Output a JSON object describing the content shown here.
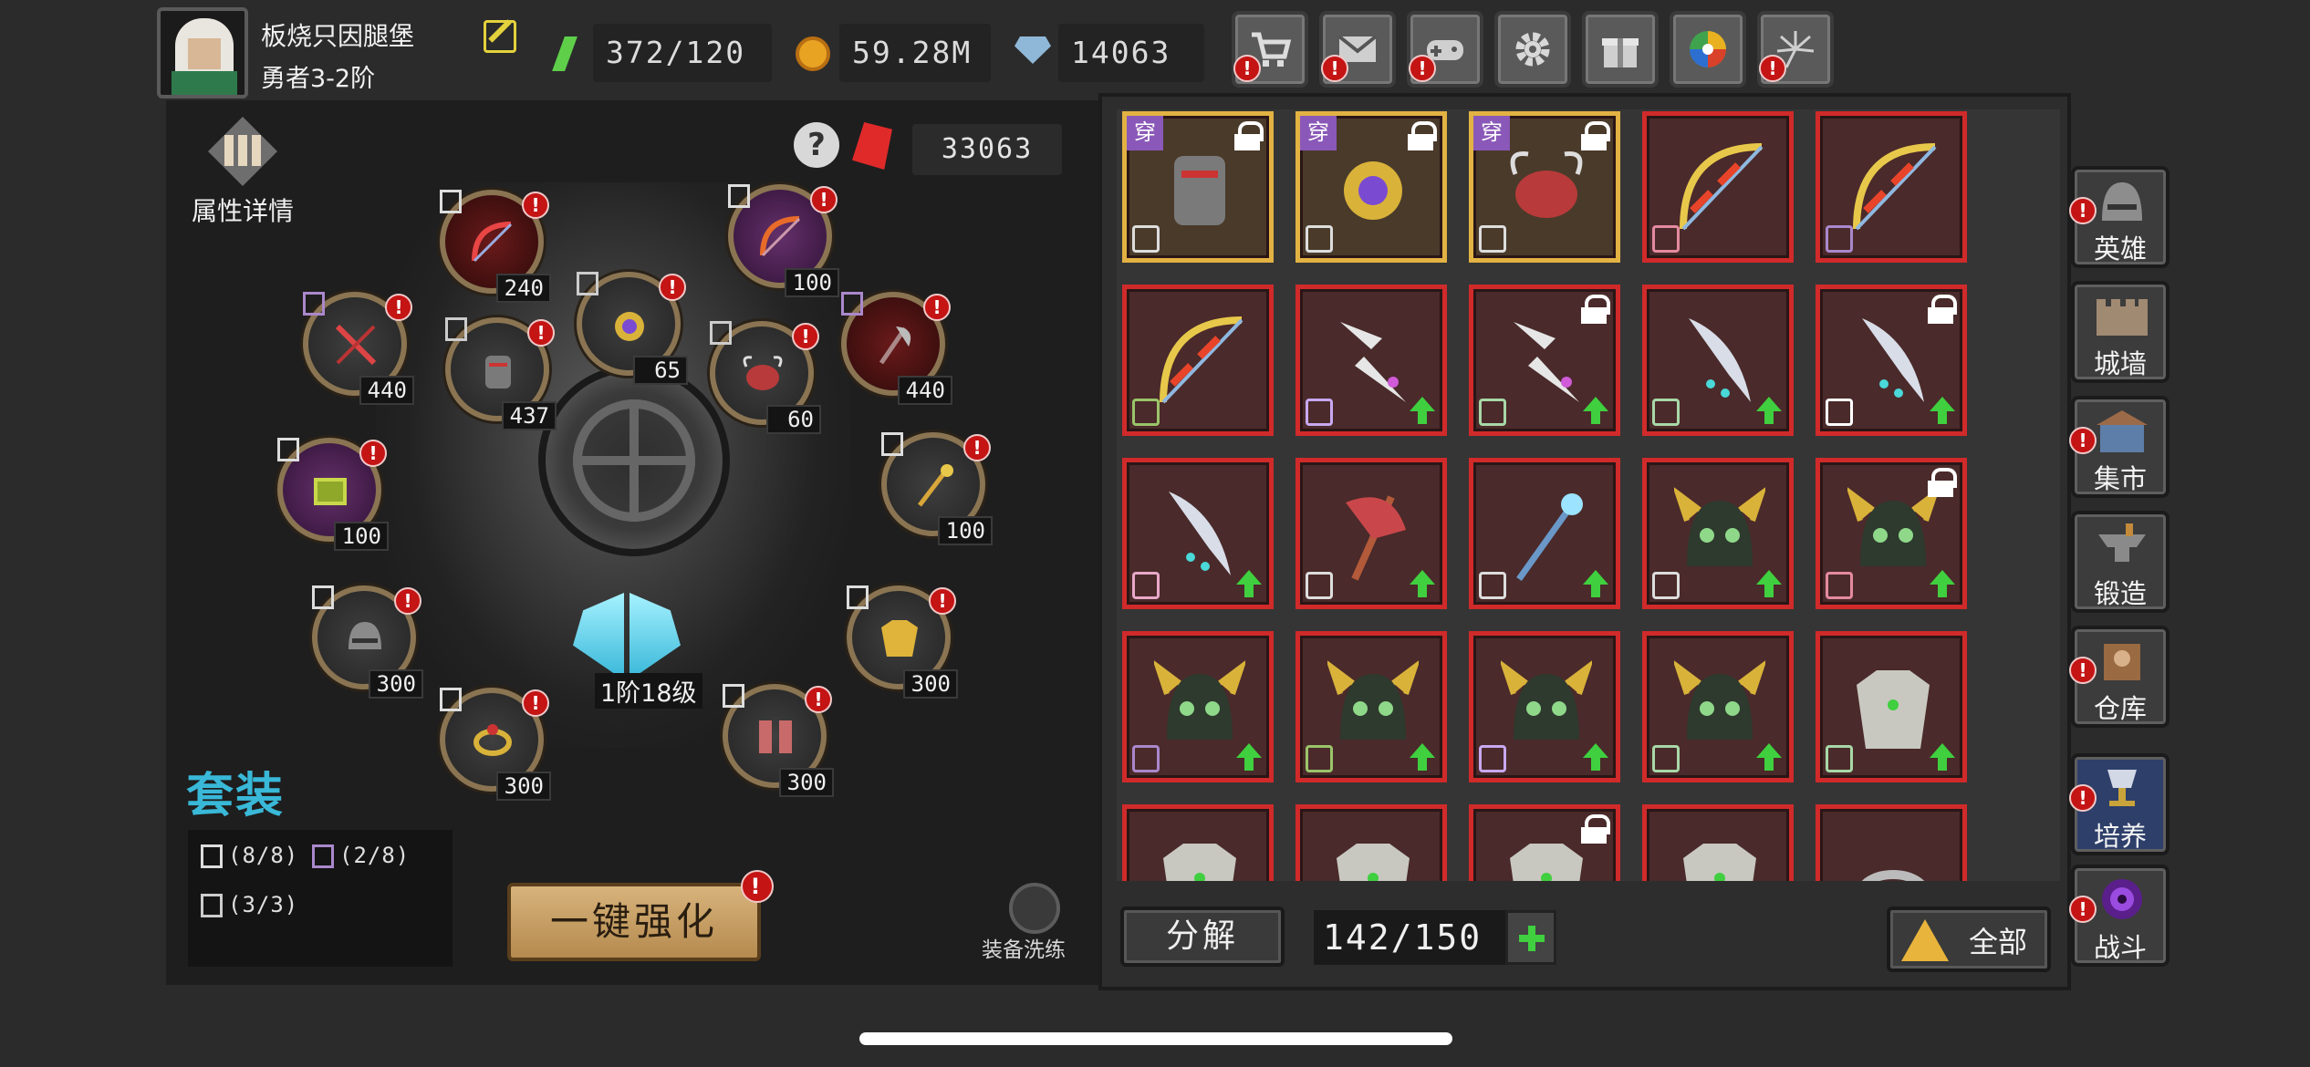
{
  "player": {
    "name": "板烧只因腿堡",
    "rank": "勇者3-2阶"
  },
  "resources": {
    "stamina": "372/120",
    "gold": "59.28M",
    "gems": "14063"
  },
  "top_buttons": [
    {
      "icon": "shop-cart-icon",
      "badge": "!"
    },
    {
      "icon": "mail-icon",
      "badge": "!"
    },
    {
      "icon": "gamepad-icon",
      "badge": "!"
    },
    {
      "icon": "gear-icon",
      "badge": ""
    },
    {
      "icon": "gift-icon",
      "badge": ""
    },
    {
      "icon": "color-wheel-icon",
      "badge": ""
    },
    {
      "icon": "fireworks-icon",
      "badge": "!"
    }
  ],
  "left_panel": {
    "attr_label": "属性详情",
    "ruby_count": "33063",
    "help_glyph": "?",
    "center_level": "1阶18级",
    "set_title": "套装",
    "sets": [
      "(8/8)",
      "(2/8)",
      "(3/3)"
    ],
    "enhance_label": "一键强化",
    "refine_label": "装备洗练",
    "slots": [
      {
        "level": "240",
        "badge": "!"
      },
      {
        "level": "100",
        "badge": "!"
      },
      {
        "level": "440",
        "badge": "!"
      },
      {
        "level": "437",
        "badge": "!"
      },
      {
        "level": "65",
        "badge": "!"
      },
      {
        "level": "60",
        "badge": "!"
      },
      {
        "level": "440",
        "badge": "!"
      },
      {
        "level": "100",
        "badge": "!"
      },
      {
        "level": "100",
        "badge": "!"
      },
      {
        "level": "300",
        "badge": "!"
      },
      {
        "level": "300",
        "badge": "!"
      },
      {
        "level": "300",
        "badge": "!"
      },
      {
        "level": "300",
        "badge": "!"
      }
    ]
  },
  "inventory": {
    "wear_label": "穿",
    "decompose_label": "分解",
    "capacity": "142/150",
    "filter_label": "全部",
    "items": [
      {
        "art": "armor",
        "wear": true,
        "lock": true,
        "up": false,
        "frame": "gold"
      },
      {
        "art": "amulet",
        "wear": true,
        "lock": true,
        "up": false,
        "frame": "gold"
      },
      {
        "art": "crab-armor",
        "wear": true,
        "lock": true,
        "up": false,
        "frame": "gold"
      },
      {
        "art": "bow",
        "wear": false,
        "lock": false,
        "up": false,
        "frame": "red"
      },
      {
        "art": "bow",
        "wear": false,
        "lock": false,
        "up": false,
        "frame": "red"
      },
      {
        "art": "bow",
        "wear": false,
        "lock": false,
        "up": false,
        "frame": "red"
      },
      {
        "art": "lightning-sword",
        "wear": false,
        "lock": false,
        "up": true,
        "frame": "red"
      },
      {
        "art": "lightning-sword",
        "wear": false,
        "lock": true,
        "up": true,
        "frame": "red"
      },
      {
        "art": "crystal-blade",
        "wear": false,
        "lock": false,
        "up": true,
        "frame": "red"
      },
      {
        "art": "crystal-blade",
        "wear": false,
        "lock": true,
        "up": true,
        "frame": "red"
      },
      {
        "art": "crystal-blade",
        "wear": false,
        "lock": false,
        "up": true,
        "frame": "red"
      },
      {
        "art": "axe",
        "wear": false,
        "lock": false,
        "up": true,
        "frame": "red"
      },
      {
        "art": "staff",
        "wear": false,
        "lock": false,
        "up": true,
        "frame": "red"
      },
      {
        "art": "helmet",
        "wear": false,
        "lock": false,
        "up": true,
        "frame": "red"
      },
      {
        "art": "helmet",
        "wear": false,
        "lock": true,
        "up": true,
        "frame": "red"
      },
      {
        "art": "helmet",
        "wear": false,
        "lock": false,
        "up": true,
        "frame": "red"
      },
      {
        "art": "helmet",
        "wear": false,
        "lock": false,
        "up": true,
        "frame": "red"
      },
      {
        "art": "helmet",
        "wear": false,
        "lock": false,
        "up": true,
        "frame": "red"
      },
      {
        "art": "helmet",
        "wear": false,
        "lock": false,
        "up": true,
        "frame": "red"
      },
      {
        "art": "chest-armor",
        "wear": false,
        "lock": false,
        "up": true,
        "frame": "red"
      },
      {
        "art": "chest-armor",
        "wear": false,
        "lock": false,
        "up": false,
        "frame": "red"
      },
      {
        "art": "chest-armor",
        "wear": false,
        "lock": false,
        "up": false,
        "frame": "red"
      },
      {
        "art": "chest-armor",
        "wear": false,
        "lock": true,
        "up": false,
        "frame": "red"
      },
      {
        "art": "chest-armor",
        "wear": false,
        "lock": false,
        "up": false,
        "frame": "red"
      },
      {
        "art": "ring",
        "wear": false,
        "lock": false,
        "up": false,
        "frame": "red"
      }
    ]
  },
  "side_nav": [
    {
      "label": "英雄",
      "icon": "helmet-icon",
      "badge": "!"
    },
    {
      "label": "城墙",
      "icon": "wall-icon",
      "badge": ""
    },
    {
      "label": "集市",
      "icon": "market-icon",
      "badge": "!"
    },
    {
      "label": "锻造",
      "icon": "anvil-icon",
      "badge": ""
    },
    {
      "label": "仓库",
      "icon": "warehouse-icon",
      "badge": "!"
    },
    {
      "label": "培养",
      "icon": "chalice-icon",
      "badge": "!"
    },
    {
      "label": "战斗",
      "icon": "portal-icon",
      "badge": "!"
    }
  ],
  "colors": {
    "accent_set": "#39b8d8",
    "badge": "#c41414",
    "frame_red": "#d02a2a",
    "frame_gold": "#e2b243",
    "upgrade": "#3fcf3f"
  }
}
